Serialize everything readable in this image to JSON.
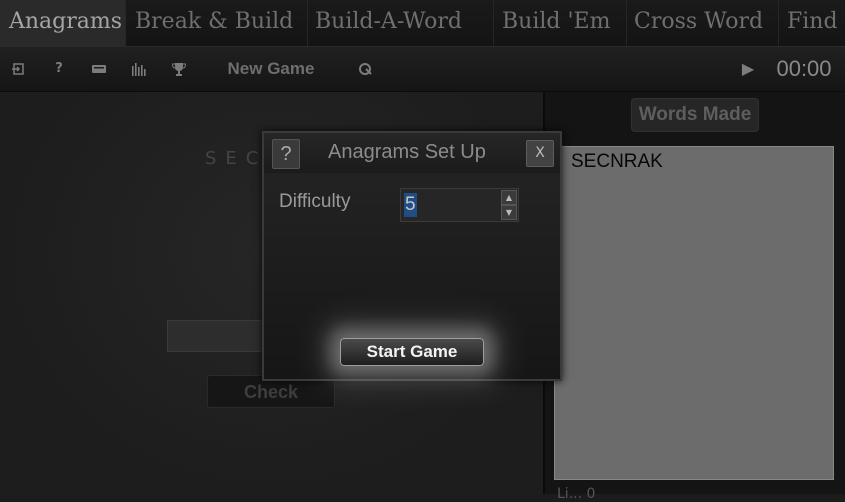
{
  "menu": {
    "items": [
      {
        "label": "Anagrams",
        "active": true
      },
      {
        "label": "Break & Build"
      },
      {
        "label": "Build-A-Word"
      },
      {
        "label": "Build 'Em"
      },
      {
        "label": "Cross Word"
      },
      {
        "label": "Find"
      }
    ]
  },
  "toolbar": {
    "icons": [
      "exit-icon",
      "help-icon",
      "keyboard-icon",
      "stats-icon",
      "trophy-icon",
      "reset-icon",
      "play-icon"
    ],
    "new_game_label": "New Game",
    "help_glyph": "?",
    "play_glyph": "▶",
    "timer": "00:00"
  },
  "game": {
    "scrambled_word": "SEC",
    "check_label": "Check"
  },
  "words_panel": {
    "header": "Words Made",
    "words": [
      "SECNRAK"
    ],
    "footer": "Li... 0"
  },
  "dialog": {
    "help_label": "?",
    "title": "Anagrams Set Up",
    "close_label": "X",
    "difficulty_label": "Difficulty",
    "difficulty_value": "5",
    "start_label": "Start Game"
  },
  "colors": {
    "background": "#1c1c1c",
    "accent_selection": "#1f4d84",
    "list_background": "#6c6c6c"
  }
}
